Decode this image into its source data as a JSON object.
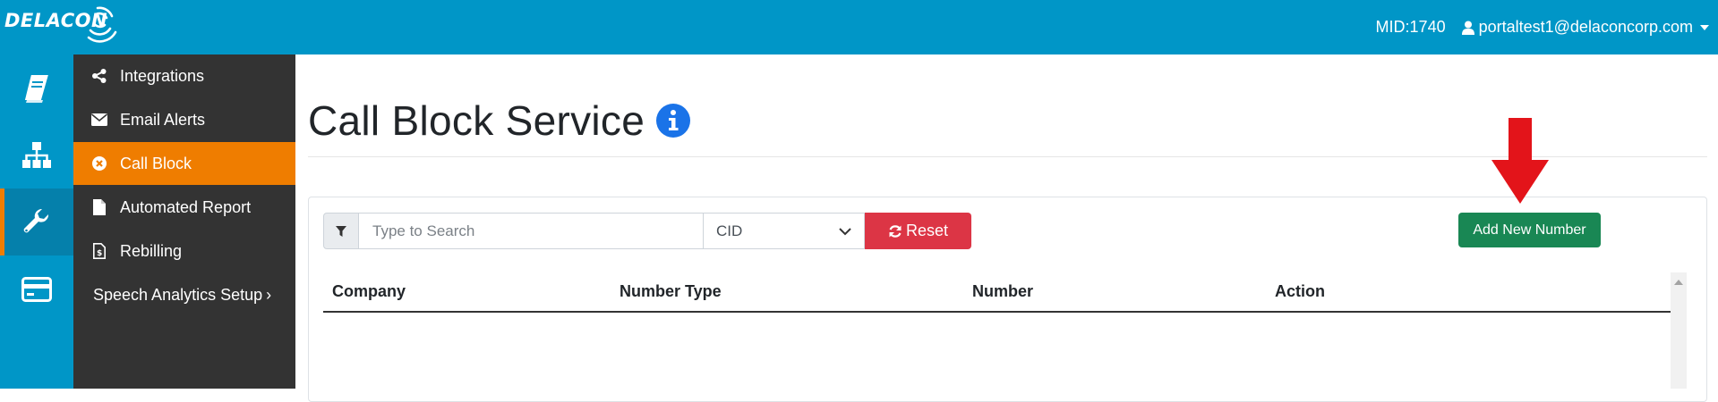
{
  "header": {
    "logo_text": "DELACON",
    "mid": "MID:1740",
    "user_email": "portaltest1@delaconcorp.com"
  },
  "rail": {
    "items": [
      {
        "icon": "book-icon"
      },
      {
        "icon": "sitemap-icon"
      },
      {
        "icon": "wrench-icon",
        "active": true
      },
      {
        "icon": "credit-card-icon"
      }
    ]
  },
  "subnav": {
    "items": [
      {
        "label": "Integrations",
        "icon": "share-icon"
      },
      {
        "label": "Email Alerts",
        "icon": "envelope-icon"
      },
      {
        "label": "Call Block",
        "icon": "times-circle-icon",
        "active": true
      },
      {
        "label": "Automated Report",
        "icon": "file-icon"
      },
      {
        "label": "Rebilling",
        "icon": "file-invoice-icon"
      },
      {
        "label": "Speech Analytics Setup",
        "icon": "chevron-right-icon"
      }
    ]
  },
  "main": {
    "title": "Call Block Service",
    "search": {
      "placeholder": "Type to Search",
      "value": ""
    },
    "select": {
      "value": "CID"
    },
    "reset_label": "Reset",
    "add_label": "Add New Number",
    "table": {
      "columns": [
        "Company",
        "Number Type",
        "Number",
        "Action"
      ],
      "rows": []
    }
  },
  "colors": {
    "brand_blue": "#0096c7",
    "accent_orange": "#ef7d00",
    "sidebar_dark": "#333333",
    "reset_red": "#dc3545",
    "add_green": "#198754",
    "annotation_arrow": "#e3141a"
  }
}
